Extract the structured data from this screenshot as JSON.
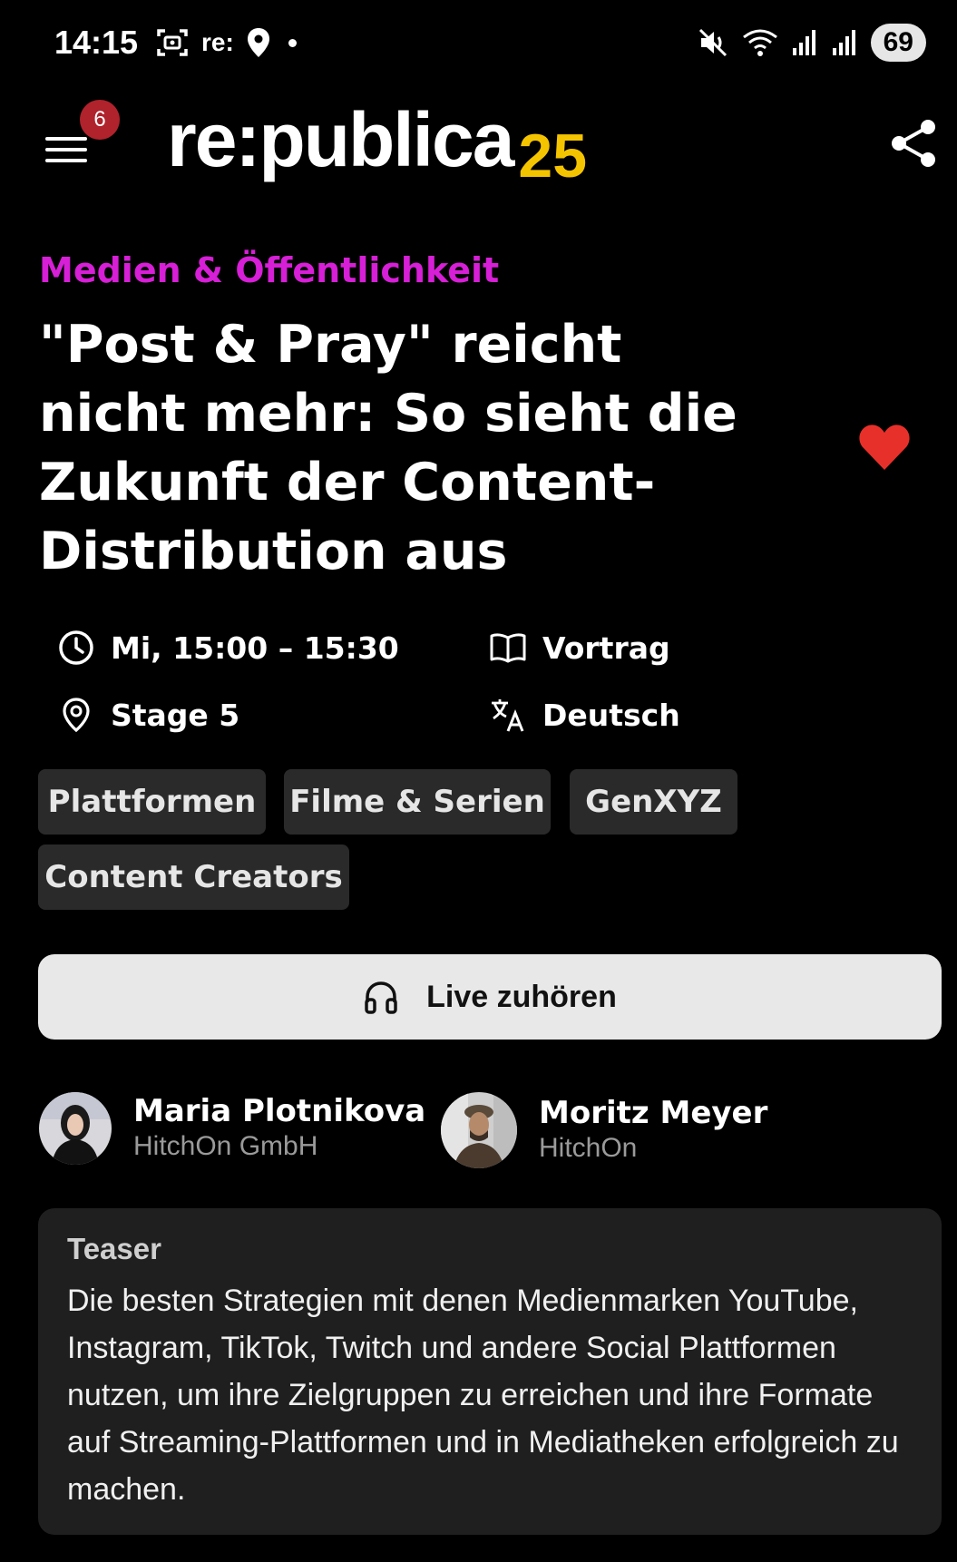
{
  "status_bar": {
    "time": "14:15",
    "app_label": "re:",
    "battery": "69",
    "icons": [
      "screenshot-icon",
      "location-icon",
      "mute-icon",
      "wifi-icon",
      "signal-icon",
      "signal-icon"
    ]
  },
  "header": {
    "notification_count": "6",
    "logo_text": "re:publica",
    "logo_number": "25",
    "icons": [
      "menu-icon",
      "share-icon"
    ]
  },
  "session": {
    "category": "Medien & Öffentlichkeit",
    "title": "\"Post & Pray\" reicht nicht mehr: So sieht die Zukunft der Content-Distribution aus",
    "time": "Mi, 15:00 – 15:30",
    "format": "Vortrag",
    "location": "Stage 5",
    "language": "Deutsch",
    "favorited": true
  },
  "tags": [
    "Plattformen",
    "Filme & Serien",
    "GenXYZ",
    "Content Creators"
  ],
  "listen_button": "Live zuhören",
  "speakers": [
    {
      "name": "Maria Plotnikova",
      "org": "HitchOn GmbH"
    },
    {
      "name": "Moritz Meyer",
      "org": "HitchOn"
    }
  ],
  "teaser": {
    "label": "Teaser",
    "text": "Die besten Strategien mit denen Medienmarken YouTube, Instagram, TikTok, Twitch und andere Social Plattformen nutzen, um ihre Zielgruppen zu erreichen und ihre Formate auf Streaming-Plattformen und in Mediatheken erfolgreich zu machen."
  },
  "colors": {
    "background": "#000000",
    "category": "#d61fd6",
    "accent_logo": "#f5c400",
    "heart": "#e8302a",
    "badge": "#b0222c",
    "tag_bg": "#2a2a2a",
    "card_bg": "#1f1f1f"
  }
}
